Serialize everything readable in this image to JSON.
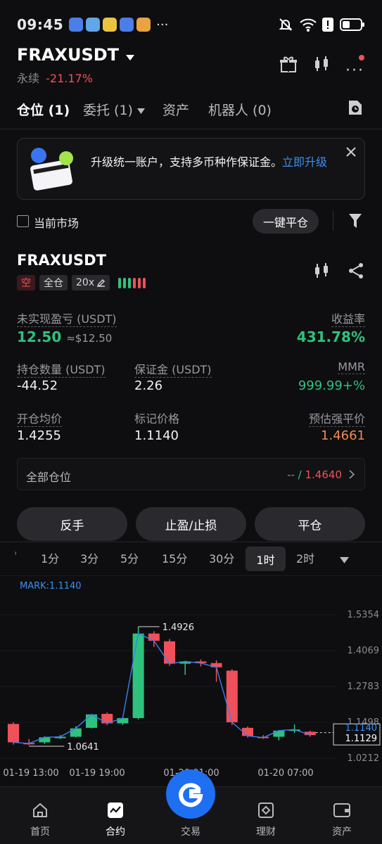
{
  "status_bar": {
    "time": "09:45",
    "dots": "···"
  },
  "header": {
    "symbol": "FRAXUSDT",
    "type": "永续",
    "change": "-21.17%"
  },
  "tabs": [
    {
      "label": "仓位 (1)"
    },
    {
      "label": "委托 (1)"
    },
    {
      "label": "资产"
    },
    {
      "label": "机器人 (0)"
    }
  ],
  "banner": {
    "text": "升级统一账户，支持多币种作保证金。",
    "link": "立即升级"
  },
  "filter": {
    "current_market": "当前市场",
    "close_all": "一键平仓"
  },
  "position": {
    "symbol": "FRAXUSDT",
    "side": "空",
    "margin_mode": "全仓",
    "leverage": "20x",
    "unrealized_label": "未实现盈亏 (USDT)",
    "unrealized_value": "12.50",
    "unrealized_approx": "≈$12.50",
    "roe_label": "收益率",
    "roe_value": "431.78%",
    "size_label": "持仓数量 (USDT)",
    "size_value": "-44.52",
    "margin_label": "保证金 (USDT)",
    "margin_value": "2.26",
    "mmr_label": "MMR",
    "mmr_value": "999.99+%",
    "entry_label": "开仓均价",
    "entry_value": "1.4255",
    "mark_label": "标记价格",
    "mark_value": "1.1140",
    "liq_label": "预估强平价",
    "liq_value": "1.4661",
    "all_positions_label": "全部仓位",
    "all_positions_value_a": "-- /",
    "all_positions_value_b": "1.4640"
  },
  "actions": {
    "reverse": "反手",
    "tpsl": "止盈/止损",
    "close": "平仓"
  },
  "timeframes": [
    "1分",
    "3分",
    "5分",
    "15分",
    "30分",
    "1时",
    "2时"
  ],
  "active_timeframe": "1时",
  "chart_data": {
    "type": "candlestick",
    "mark_label": "MARK:1.1140",
    "y_ticks": [
      "1.5354",
      "1.4069",
      "1.2783",
      "1.1498",
      "1.0212"
    ],
    "y_tick_values": [
      1.5354,
      1.4069,
      1.2783,
      1.1498,
      1.0212
    ],
    "x_ticks": [
      "01-19 13:00",
      "01-19 19:00",
      "01-20 01:00",
      "01-20 07:00"
    ],
    "high_label": "1.4926",
    "low_label": "1.0641",
    "last_price_label": "1.1140",
    "last_price2_label": "1.1129",
    "candles": [
      {
        "o": 1.144,
        "h": 1.15,
        "c": 1.078,
        "l": 1.07
      },
      {
        "o": 1.076,
        "h": 1.09,
        "c": 1.074,
        "l": 1.068
      },
      {
        "o": 1.078,
        "h": 1.1,
        "c": 1.096,
        "l": 1.072
      },
      {
        "o": 1.096,
        "h": 1.104,
        "c": 1.098,
        "l": 1.09
      },
      {
        "o": 1.098,
        "h": 1.136,
        "c": 1.128,
        "l": 1.096
      },
      {
        "o": 1.13,
        "h": 1.18,
        "c": 1.178,
        "l": 1.128
      },
      {
        "o": 1.18,
        "h": 1.185,
        "c": 1.146,
        "l": 1.14
      },
      {
        "o": 1.146,
        "h": 1.168,
        "c": 1.165,
        "l": 1.14
      },
      {
        "o": 1.165,
        "h": 1.4926,
        "c": 1.468,
        "l": 1.16
      },
      {
        "o": 1.468,
        "h": 1.476,
        "c": 1.442,
        "l": 1.42
      },
      {
        "o": 1.44,
        "h": 1.448,
        "c": 1.36,
        "l": 1.352
      },
      {
        "o": 1.36,
        "h": 1.37,
        "c": 1.368,
        "l": 1.32
      },
      {
        "o": 1.368,
        "h": 1.375,
        "c": 1.362,
        "l": 1.35
      },
      {
        "o": 1.362,
        "h": 1.372,
        "c": 1.347,
        "l": 1.295
      },
      {
        "o": 1.335,
        "h": 1.34,
        "c": 1.15,
        "l": 1.14
      },
      {
        "o": 1.13,
        "h": 1.135,
        "c": 1.101,
        "l": 1.095
      },
      {
        "o": 1.098,
        "h": 1.104,
        "c": 1.095,
        "l": 1.09
      },
      {
        "o": 1.098,
        "h": 1.122,
        "c": 1.12,
        "l": 1.085
      },
      {
        "o": 1.122,
        "h": 1.142,
        "c": 1.124,
        "l": 1.112
      },
      {
        "o": 1.116,
        "h": 1.12,
        "c": 1.104,
        "l": 1.098
      }
    ]
  },
  "bottom_nav": [
    {
      "label": "首页"
    },
    {
      "label": "合约"
    },
    {
      "label": "交易"
    },
    {
      "label": "理财"
    },
    {
      "label": "资产"
    }
  ],
  "colors": {
    "up": "#2ec27e",
    "down": "#f0505a",
    "accent": "#3b8ef0",
    "bg": "#0e0e10"
  }
}
